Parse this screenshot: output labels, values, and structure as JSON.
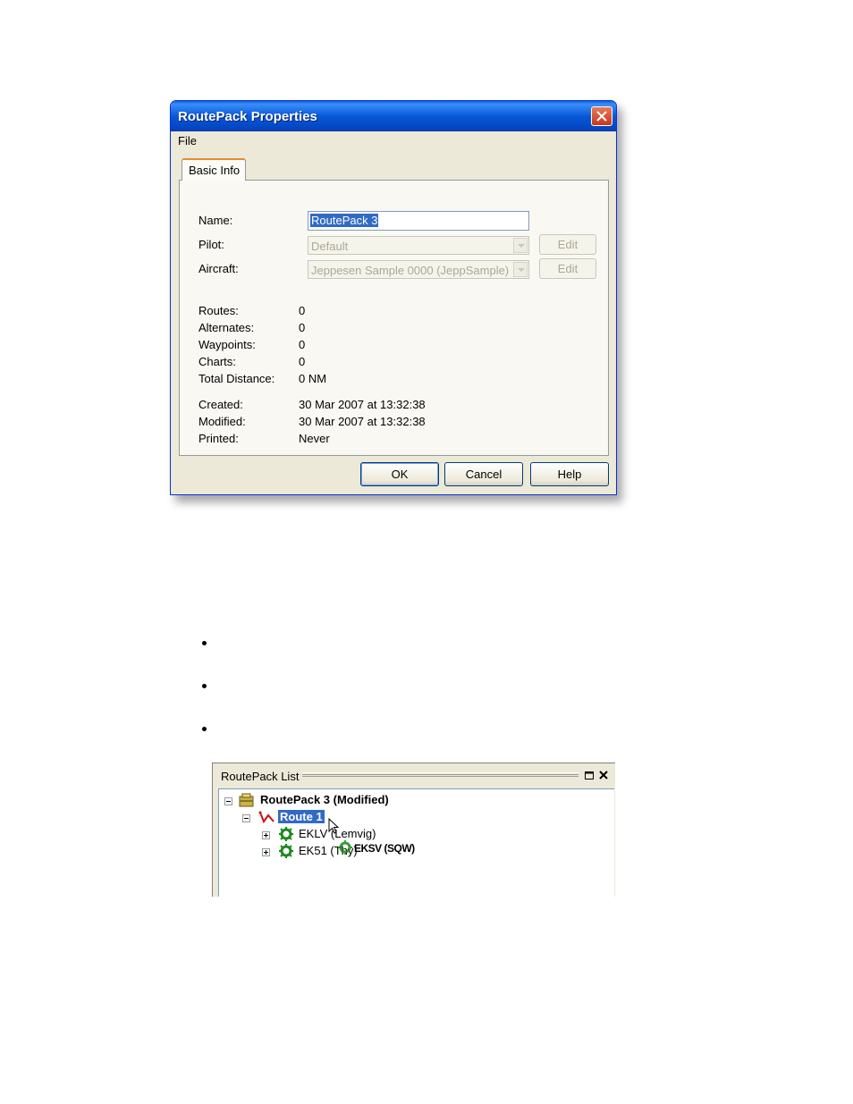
{
  "dialog": {
    "title": "RoutePack Properties",
    "menu": [
      "File"
    ],
    "tab_label": "Basic Info",
    "fields": {
      "name_label": "Name:",
      "name_value": "RoutePack 3",
      "pilot_label": "Pilot:",
      "pilot_value": "Default",
      "aircraft_label": "Aircraft:",
      "aircraft_value": "Jeppesen Sample 0000 (JeppSample)",
      "edit_label": "Edit"
    },
    "stats": [
      {
        "label": "Routes:",
        "value": "0"
      },
      {
        "label": "Alternates:",
        "value": "0"
      },
      {
        "label": "Waypoints:",
        "value": "0"
      },
      {
        "label": "Charts:",
        "value": "0"
      },
      {
        "label": "Total Distance:",
        "value": "0 NM"
      }
    ],
    "dates": [
      {
        "label": "Created:",
        "value": "30 Mar 2007 at 13:32:38"
      },
      {
        "label": "Modified:",
        "value": "30 Mar 2007 at 13:32:38"
      },
      {
        "label": "Printed:",
        "value": "Never"
      }
    ],
    "buttons": {
      "ok": "OK",
      "cancel": "Cancel",
      "help": "Help"
    }
  },
  "routepack_list": {
    "title": "RoutePack List",
    "root": "RoutePack 3 (Modified)",
    "route": "Route 1",
    "airports": [
      "EKLV (Lemvig)",
      "EK51 (Thy)"
    ],
    "drag_label": "EKSV (SQW)"
  },
  "colors": {
    "selection": "#316ac5",
    "dialog_bg": "#ece9d8",
    "titlebar": "#0858d8"
  }
}
